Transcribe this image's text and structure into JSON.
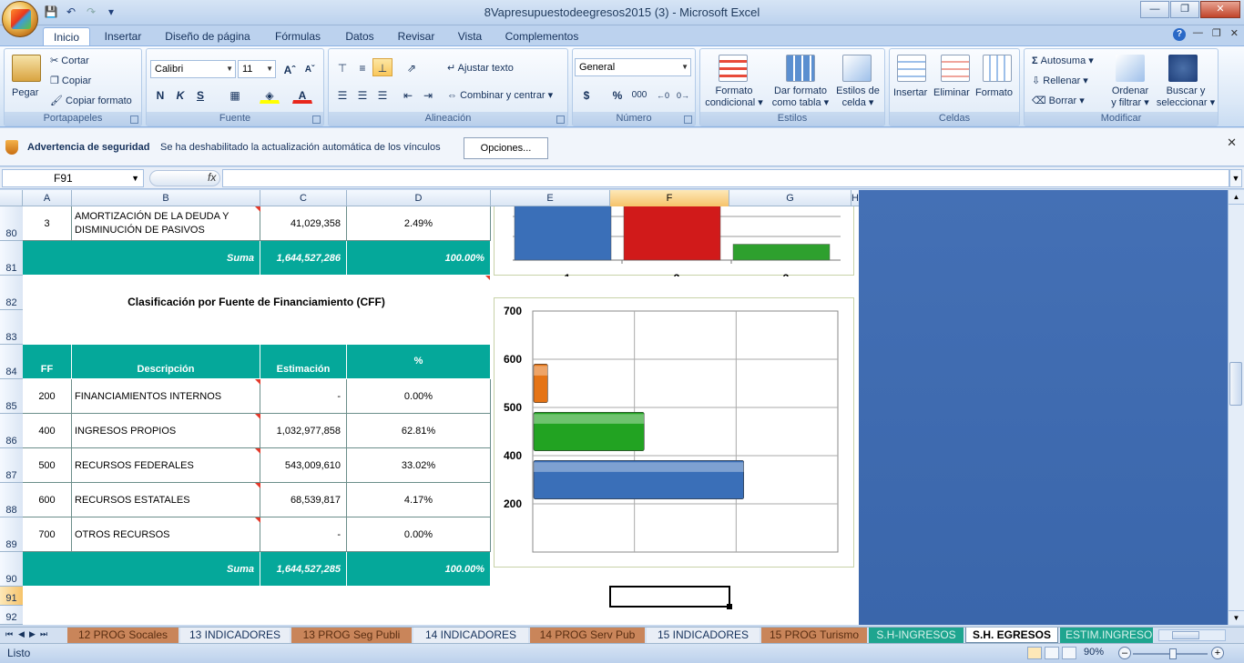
{
  "window": {
    "title": "8Vapresupuestodeegresos2015 (3)  -  Microsoft Excel"
  },
  "ribbon_tabs": [
    "Inicio",
    "Insertar",
    "Diseño de página",
    "Fórmulas",
    "Datos",
    "Revisar",
    "Vista",
    "Complementos"
  ],
  "ribbon": {
    "portapapeles": {
      "label": "Portapapeles",
      "pegar": "Pegar",
      "cortar": "Cortar",
      "copiar": "Copiar",
      "copiar_formato": "Copiar formato"
    },
    "fuente": {
      "label": "Fuente",
      "font": "Calibri",
      "size": "11",
      "bold": "N",
      "italic": "K",
      "underline": "S"
    },
    "alineacion": {
      "label": "Alineación",
      "ajustar": "Ajustar texto",
      "combinar": "Combinar y centrar"
    },
    "numero": {
      "label": "Número",
      "format": "General",
      "currency": "$",
      "percent": "%",
      "thousands": "000"
    },
    "estilos": {
      "label": "Estilos",
      "formato_condicional_1": "Formato",
      "formato_condicional_2": "condicional",
      "formato_tabla_1": "Dar formato",
      "formato_tabla_2": "como tabla",
      "estilos_celda_1": "Estilos de",
      "estilos_celda_2": "celda"
    },
    "celdas": {
      "label": "Celdas",
      "insertar": "Insertar",
      "eliminar": "Eliminar",
      "formato": "Formato"
    },
    "modificar": {
      "label": "Modificar",
      "autosuma": "Autosuma",
      "rellenar": "Rellenar",
      "borrar": "Borrar",
      "ordenar_1": "Ordenar",
      "ordenar_2": "y filtrar",
      "buscar_1": "Buscar y",
      "buscar_2": "seleccionar"
    }
  },
  "security_bar": {
    "title": "Advertencia de seguridad",
    "message": "Se ha deshabilitado la actualización automática de los vínculos",
    "button": "Opciones..."
  },
  "formula_bar": {
    "name_box": "F91",
    "fx": "fx",
    "formula": ""
  },
  "columns": [
    "A",
    "B",
    "C",
    "D",
    "E",
    "F",
    "G",
    "H"
  ],
  "rows": [
    "80",
    "81",
    "82",
    "83",
    "84",
    "85",
    "86",
    "87",
    "88",
    "89",
    "90",
    "91",
    "92"
  ],
  "table_top": {
    "row80": {
      "a": "3",
      "b1": "AMORTIZACIÓN DE LA DEUDA Y",
      "b2": "DISMINUCIÓN DE PASIVOS",
      "c": "41,029,358",
      "d": "2.49%"
    },
    "row81": {
      "label": "Suma",
      "c": "1,644,527,286",
      "d": "100.00%"
    }
  },
  "cff": {
    "title": "Clasificación por Fuente de Financiamiento (CFF)",
    "headers": {
      "ff": "FF",
      "desc": "Descripción",
      "est": "Estimación",
      "pct": "%"
    },
    "rows": [
      {
        "ff": "200",
        "desc": "FINANCIAMIENTOS INTERNOS",
        "est": "-",
        "pct": "0.00%"
      },
      {
        "ff": "400",
        "desc": "INGRESOS PROPIOS",
        "est": "1,032,977,858",
        "pct": "62.81%"
      },
      {
        "ff": "500",
        "desc": "RECURSOS FEDERALES",
        "est": "543,009,610",
        "pct": "33.02%"
      },
      {
        "ff": "600",
        "desc": "RECURSOS ESTATALES",
        "est": "68,539,817",
        "pct": "4.17%"
      },
      {
        "ff": "700",
        "desc": "OTROS RECURSOS",
        "est": "-",
        "pct": "0.00%"
      }
    ],
    "total": {
      "label": "Suma",
      "est": "1,644,527,285",
      "pct": "100.00%"
    }
  },
  "chart_data": [
    {
      "type": "bar",
      "categories": [
        "1",
        "2",
        "3"
      ],
      "colors": [
        "#3a6fb8",
        "#d11a1a",
        "#2ea02e"
      ],
      "values": [
        1.6,
        0.85,
        0.15
      ],
      "ylim": [
        0,
        1.1
      ]
    },
    {
      "type": "bar",
      "orientation": "horizontal",
      "categories": [
        "200",
        "400",
        "500",
        "600",
        "700"
      ],
      "values": [
        0,
        1032977858,
        543009610,
        68539817,
        0
      ],
      "colors": [
        "#888888",
        "#3a6fb8",
        "#22a322",
        "#e57416",
        "#888888"
      ],
      "xlim": [
        0,
        1500000000
      ],
      "grid": true
    }
  ],
  "sheet_tabs": [
    "12 PROG Socales",
    "13 INDICADORES",
    "13 PROG Seg Publi",
    "14 INDICADORES",
    "14 PROG Serv Pub",
    "15 INDICADORES",
    "15 PROG Turismo",
    "S.H-INGRESOS",
    "S.H. EGRESOS",
    "ESTIM.INGRESO"
  ],
  "active_sheet": "S.H. EGRESOS",
  "status": {
    "text": "Listo",
    "zoom": "90%"
  }
}
